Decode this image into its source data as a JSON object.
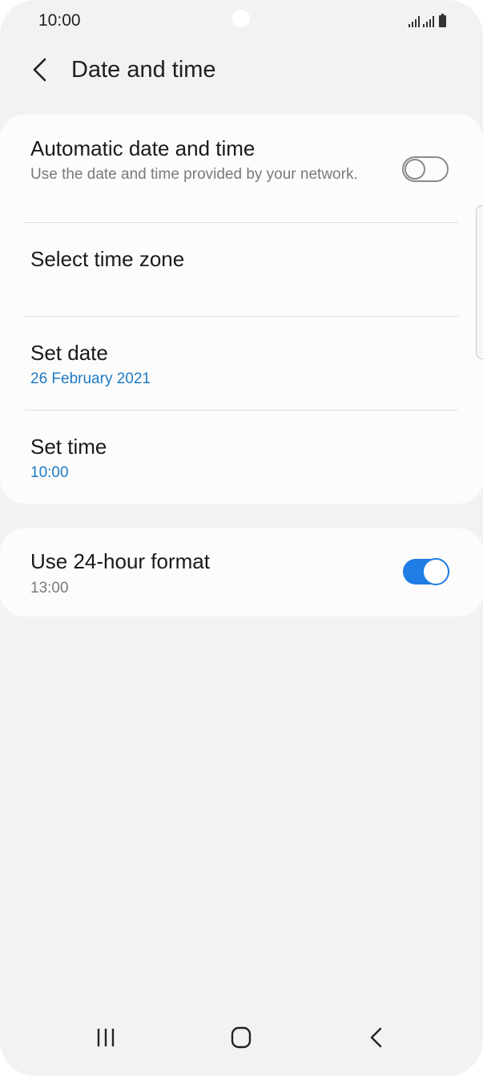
{
  "status_bar": {
    "time": "10:00"
  },
  "header": {
    "title": "Date and time",
    "back_icon": "chevron-left-icon"
  },
  "settings": {
    "automatic": {
      "title": "Automatic date and time",
      "subtitle": "Use the date and time provided by your network.",
      "toggle_state": "off"
    },
    "time_zone": {
      "title": "Select time zone"
    },
    "set_date": {
      "title": "Set date",
      "value": "26 February 2021"
    },
    "set_time": {
      "title": "Set time",
      "value": "10:00"
    },
    "format_24h": {
      "title": "Use 24-hour format",
      "subtitle": "13:00",
      "toggle_state": "on"
    }
  },
  "nav_bar": {
    "recents_icon": "recents-icon",
    "home_icon": "home-icon",
    "back_icon": "back-icon"
  },
  "colors": {
    "accent": "#1f7de3",
    "link_blue": "#1d7ac4",
    "background": "#f2f2f2",
    "card": "#fcfcfc"
  }
}
